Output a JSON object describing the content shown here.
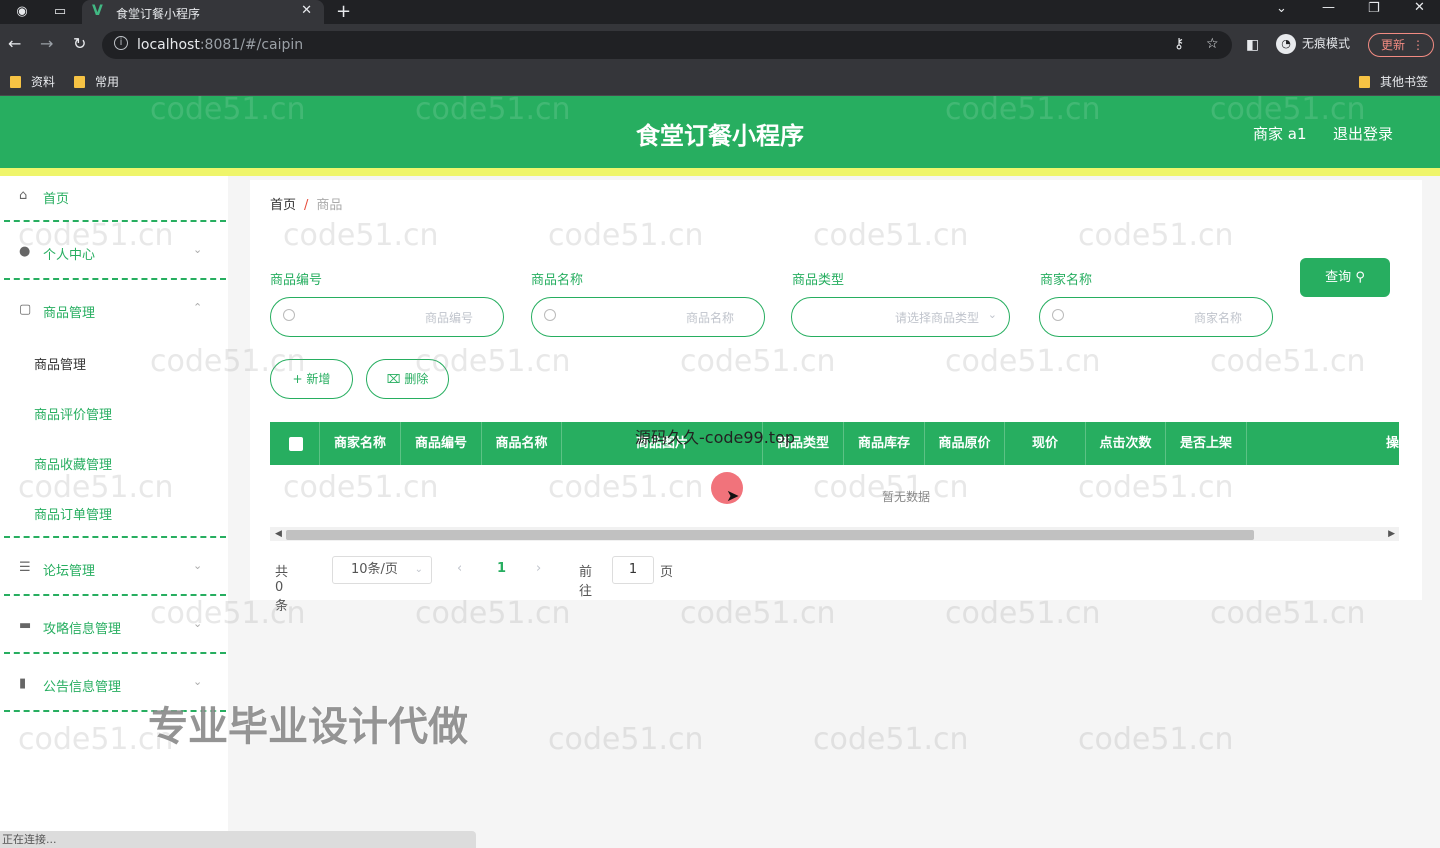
{
  "browser": {
    "tab_title": "食堂订餐小程序",
    "tab_favicon": "V",
    "url_host": "localhost",
    "url_rest": ":8081/#/caipin",
    "incognito_label": "无痕模式",
    "update_label": "更新",
    "bookmarks": [
      "资料",
      "常用"
    ],
    "other_bookmarks": "其他书签"
  },
  "header": {
    "title": "食堂订餐小程序",
    "user": "商家 a1",
    "logout": "退出登录"
  },
  "sidebar": {
    "home": "首页",
    "personal": "个人中心",
    "goods_mgmt": "商品管理",
    "sub_goods": "商品管理",
    "sub_review": "商品评价管理",
    "sub_fav": "商品收藏管理",
    "sub_order": "商品订单管理",
    "forum": "论坛管理",
    "guide": "攻略信息管理",
    "notice": "公告信息管理"
  },
  "breadcrumb": {
    "home": "首页",
    "sep": "/",
    "current": "商品"
  },
  "filters": {
    "code_label": "商品编号",
    "code_ph": "商品编号",
    "name_label": "商品名称",
    "name_ph": "商品名称",
    "type_label": "商品类型",
    "type_ph": "请选择商品类型",
    "merchant_label": "商家名称",
    "merchant_ph": "商家名称",
    "query": "查询"
  },
  "actions": {
    "add": "新增",
    "delete": "删除"
  },
  "table": {
    "columns": [
      "商家名称",
      "商品编号",
      "商品名称",
      "商品图片",
      "商品类型",
      "商品库存",
      "商品原价",
      "现价",
      "点击次数",
      "是否上架",
      "操"
    ],
    "empty": "暂无数据"
  },
  "pager": {
    "total": "共 0 条",
    "size": "10条/页",
    "page": "1",
    "goto": "前往",
    "goto_value": "1",
    "unit": "页"
  },
  "overlays": {
    "watermark": "code51.cn",
    "promo": "专业毕业设计代做",
    "source": "源码久久-code99.top",
    "status": "正在连接..."
  }
}
